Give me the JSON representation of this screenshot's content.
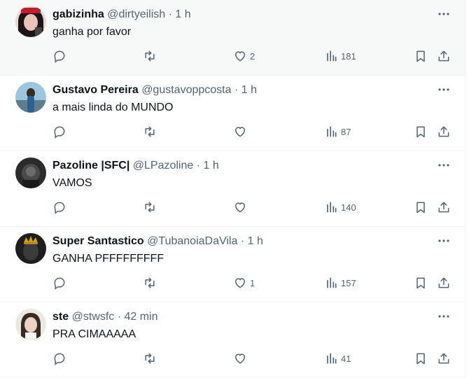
{
  "tweets": [
    {
      "name": "gabizinha",
      "handle": "@dirtyeilish",
      "time": "1 h",
      "text": "ganha por favor",
      "likes": "2",
      "views": "181",
      "avatar_icon": "avatar-photo"
    },
    {
      "name": "Gustavo Pereira",
      "handle": "@gustavoppcosta",
      "time": "1 h",
      "text": "a mais linda do MUNDO",
      "likes": "",
      "views": "87",
      "avatar_icon": "avatar-photo"
    },
    {
      "name": "Pazoline |SFC|",
      "handle": "@LPazoline",
      "time": "1 h",
      "text": "VAMOS",
      "likes": "",
      "views": "140",
      "avatar_icon": "avatar-photo"
    },
    {
      "name": "Super Santastico",
      "handle": "@TubanoiaDaVila",
      "time": "1 h",
      "text": "GANHA PFFFFFFFFF",
      "likes": "1",
      "views": "157",
      "avatar_icon": "avatar-photo"
    },
    {
      "name": "ste",
      "handle": "@stwsfc",
      "time": "42 min",
      "text": "PRA CIMAAAAA",
      "likes": "",
      "views": "41",
      "avatar_icon": "avatar-photo"
    }
  ],
  "separator": " · ",
  "colors": {
    "text": "#0f1419",
    "muted": "#536471",
    "border": "#eff3f4"
  }
}
